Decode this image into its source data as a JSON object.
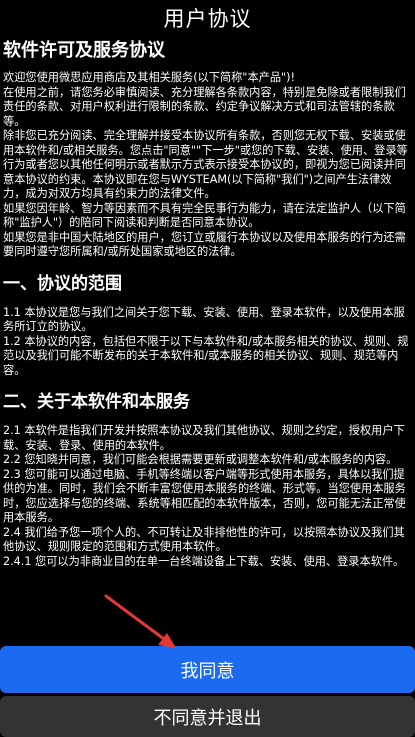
{
  "header": {
    "title": "用户协议"
  },
  "agreement": {
    "heading": "软件许可及服务协议",
    "intro": [
      "欢迎您使用微思应用商店及其相关服务(以下简称\"本产品\")!",
      "在使用之前，请您务必审慎阅读、充分理解各条款内容，特别是免除或者限制我们责任的条款、对用户权利进行限制的条款、约定争议解决方式和司法管辖的条款等。",
      "除非您已充分阅读、完全理解并接受本协议所有条款，否则您无权下载、安装或使用本软件和/或相关服务。您点击\"同意\"\"下一步\"或您的下载、安装、使用、登录等行为或者您以其他任何明示或者默示方式表示接受本协议的，即视为您已阅读并同意本协议的约束。本协议即在您与WYSTEAM(以下简称\"我们\")之间产生法律效力，成为对双方均具有约束力的法律文件。",
      "如果您因年龄、智力等因素而不具有完全民事行为能力，请在法定监护人（以下简称\"监护人\"）的陪同下阅读和判断是否同意本协议。",
      "如果您是非中国大陆地区的用户，您订立或履行本协议以及使用本服务的行为还需要同时遵守您所属和/或所处国家或地区的法律。"
    ],
    "section1": {
      "title": "一、协议的范围",
      "paras": [
        "1.1 本协议是您与我们之间关于您下载、安装、使用、登录本软件，以及使用本服务所订立的协议。",
        "1.2 本协议的内容，包括但不限于以下与本软件和/或本服务相关的协议、规则、规范以及我们可能不断发布的关于本软件和/或本服务的相关协议、规则、规范等内容。"
      ]
    },
    "section2": {
      "title": "二、关于本软件和本服务",
      "paras": [
        "2.1 本软件是指我们开发并按照本协议及我们其他协议、规则之约定，授权用户下载、安装、登录、使用的本软件。",
        "2.2 您知晓并同意，我们可能会根据需要更新或调整本软件和/或本服务的内容。",
        "2.3 您可能可以通过电脑、手机等终端以客户端等形式使用本服务，具体以我们提供的为准。同时，我们会不断丰富您使用本服务的终端、形式等。当您使用本服务时，您应选择与您的终端、系统等相匹配的本软件版本，否则，您可能无法正常使用本服务。",
        "2.4 我们给予您一项个人的、不可转让及非排他性的许可，以按照本协议及我们其他协议、规则限定的范围和方式使用本软件。",
        "2.4.1 您可以为非商业目的在单一台终端设备上下载、安装、使用、登录本软件。"
      ]
    }
  },
  "actions": {
    "agree_label": "我同意",
    "decline_label": "不同意并退出"
  },
  "colors": {
    "background": "#000000",
    "primary_button": "#1a6bf0",
    "secondary_button": "#333333",
    "annotation_arrow": "#e53935"
  }
}
